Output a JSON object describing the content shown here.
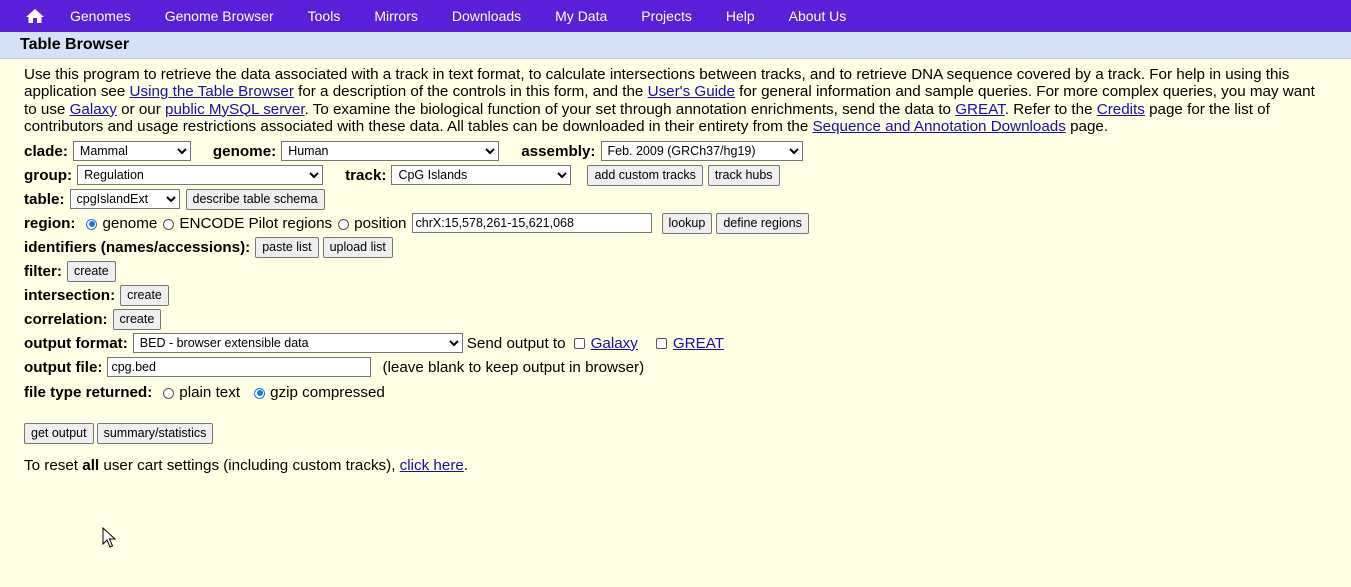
{
  "nav": {
    "items": [
      "Genomes",
      "Genome Browser",
      "Tools",
      "Mirrors",
      "Downloads",
      "My Data",
      "Projects",
      "Help",
      "About Us"
    ]
  },
  "title": "Table Browser",
  "intro": {
    "t1": "Use this program to retrieve the data associated with a track in text format, to calculate intersections between tracks, and to retrieve DNA sequence covered by a track. For help in using this application see ",
    "link_using": "Using the Table Browser",
    "t2": " for a description of the controls in this form, and the ",
    "link_guide": "User's Guide",
    "t3": " for general information and sample queries. For more complex queries, you may want to use ",
    "link_galaxy": "Galaxy",
    "t4": " or our ",
    "link_mysql": "public MySQL server",
    "t5": ". To examine the biological function of your set through annotation enrichments, send the data to ",
    "link_great": "GREAT",
    "t6": ". Refer to the ",
    "link_credits": "Credits",
    "t7": " page for the list of contributors and usage restrictions associated with these data. All tables can be downloaded in their entirety from the ",
    "link_downloads": "Sequence and Annotation Downloads",
    "t8": " page."
  },
  "form": {
    "clade_label": "clade:",
    "clade_value": "Mammal",
    "genome_label": "genome:",
    "genome_value": "Human",
    "assembly_label": "assembly:",
    "assembly_value": "Feb. 2009 (GRCh37/hg19)",
    "group_label": "group:",
    "group_value": "Regulation",
    "track_label": "track:",
    "track_value": "CpG Islands",
    "add_custom_tracks": "add custom tracks",
    "track_hubs": "track hubs",
    "table_label": "table:",
    "table_value": "cpgIslandExt",
    "describe_schema": "describe table schema",
    "region_label": "region:",
    "region_genome": "genome",
    "region_encode": "ENCODE Pilot regions",
    "region_position": "position",
    "position_value": "chrX:15,578,261-15,621,068",
    "lookup": "lookup",
    "define_regions": "define regions",
    "identifiers_label": "identifiers (names/accessions):",
    "paste_list": "paste list",
    "upload_list": "upload list",
    "filter_label": "filter:",
    "intersection_label": "intersection:",
    "correlation_label": "correlation:",
    "create": "create",
    "output_format_label": "output format:",
    "output_format_value": "BED - browser extensible data",
    "send_output_to": "Send output to",
    "galaxy": "Galaxy",
    "great": "GREAT",
    "output_file_label": "output file:",
    "output_file_value": "cpg.bed",
    "output_file_hint": "(leave blank to keep output in browser)",
    "file_type_label": "file type returned:",
    "plain_text": "plain text",
    "gzip": "gzip compressed",
    "get_output": "get output",
    "summary": "summary/statistics",
    "reset_t1": "To reset ",
    "reset_all": "all",
    "reset_t2": " user cart settings (including custom tracks), ",
    "reset_link": "click here",
    "reset_t3": "."
  },
  "colors": {
    "nav_bg": "#5a1fd8",
    "title_bg": "#d5e1f5",
    "page_bg": "#ffffe6",
    "link": "#1a0dab"
  }
}
